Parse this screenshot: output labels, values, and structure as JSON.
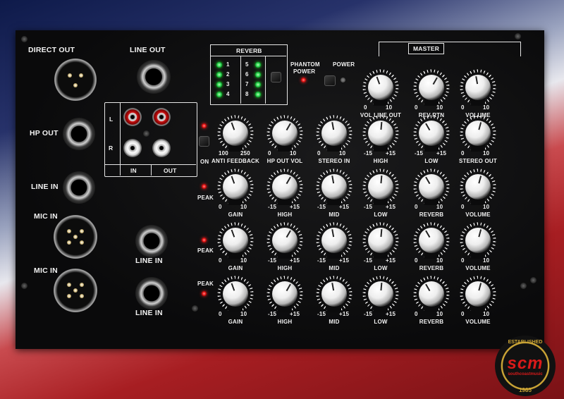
{
  "io": {
    "direct_out": "DIRECT OUT",
    "line_out": "LINE OUT",
    "hp_out": "HP OUT",
    "line_in": "LINE IN",
    "mic_in_1": "MIC IN",
    "mic_in_2": "MIC IN",
    "line_in_ch3": "LINE IN",
    "line_in_ch4": "LINE IN",
    "rca_l": "L",
    "rca_r": "R",
    "rca_in": "IN",
    "rca_out": "OUT"
  },
  "reverb": {
    "title": "REVERB",
    "presets": [
      "1",
      "2",
      "3",
      "4",
      "5",
      "6",
      "7",
      "8"
    ]
  },
  "phantom": {
    "label_line1": "PHANTOM",
    "label_line2": "POWER"
  },
  "power": {
    "label": "POWER"
  },
  "master": {
    "title": "MASTER",
    "knobs": [
      {
        "label": "VOL LINE OUT",
        "min": "0",
        "max": "10"
      },
      {
        "label": "REV RTN",
        "min": "0",
        "max": "10"
      },
      {
        "label": "VOLUME",
        "min": "0",
        "max": "10"
      }
    ]
  },
  "row1": {
    "on_label": "ON",
    "knobs": [
      {
        "label": "ANTI FEEDBACK",
        "min": "100",
        "max": "250"
      },
      {
        "label": "HP OUT VOL",
        "min": "0",
        "max": "10"
      },
      {
        "label": "STEREO IN",
        "min": "0",
        "max": "10"
      },
      {
        "label": "HIGH",
        "min": "-15",
        "max": "+15"
      },
      {
        "label": "LOW",
        "min": "-15",
        "max": "+15"
      },
      {
        "label": "STEREO OUT",
        "min": "0",
        "max": "10"
      }
    ]
  },
  "channels": [
    {
      "peak": "PEAK",
      "knobs": [
        {
          "label": "GAIN",
          "min": "0",
          "max": "10"
        },
        {
          "label": "HIGH",
          "min": "-15",
          "max": "+15"
        },
        {
          "label": "MID",
          "min": "-15",
          "max": "+15"
        },
        {
          "label": "LOW",
          "min": "-15",
          "max": "+15"
        },
        {
          "label": "REVERB",
          "min": "0",
          "max": "10"
        },
        {
          "label": "VOLUME",
          "min": "0",
          "max": "10"
        }
      ]
    },
    {
      "peak": "PEAK",
      "knobs": [
        {
          "label": "GAIN",
          "min": "0",
          "max": "10"
        },
        {
          "label": "HIGH",
          "min": "-15",
          "max": "+15"
        },
        {
          "label": "MID",
          "min": "-15",
          "max": "+15"
        },
        {
          "label": "LOW",
          "min": "-15",
          "max": "+15"
        },
        {
          "label": "REVERB",
          "min": "0",
          "max": "10"
        },
        {
          "label": "VOLUME",
          "min": "0",
          "max": "10"
        }
      ]
    },
    {
      "peak": "PEAK",
      "knobs": [
        {
          "label": "GAIN",
          "min": "0",
          "max": "10"
        },
        {
          "label": "HIGH",
          "min": "-15",
          "max": "+15"
        },
        {
          "label": "MID",
          "min": "-15",
          "max": "+15"
        },
        {
          "label": "LOW",
          "min": "-15",
          "max": "+15"
        },
        {
          "label": "REVERB",
          "min": "0",
          "max": "10"
        },
        {
          "label": "VOLUME",
          "min": "0",
          "max": "10"
        }
      ]
    }
  ],
  "logo": {
    "top": "ESTABLISHED",
    "brand": "scm",
    "sub": "southcoastmusic",
    "year": "1985"
  },
  "colors": {
    "panel": "#0b0b0c",
    "led_red": "#e01010",
    "led_green": "#18c840",
    "logo_gold": "#c9a335",
    "logo_red": "#d91a1a"
  }
}
